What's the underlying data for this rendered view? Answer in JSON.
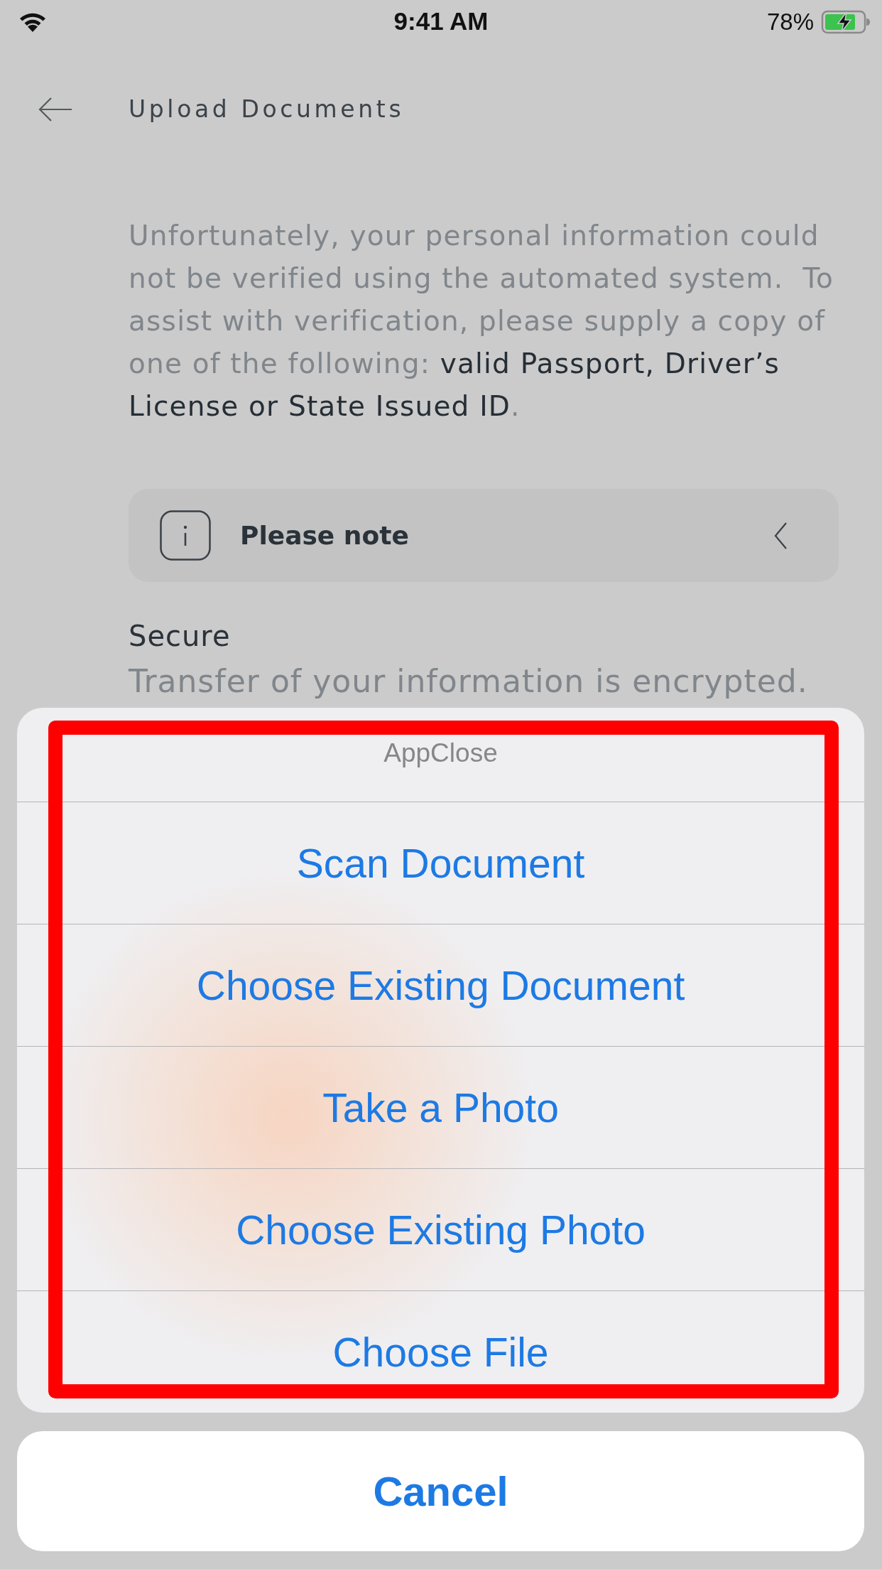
{
  "status_bar": {
    "time": "9:41 AM",
    "battery": "78%",
    "charging": true
  },
  "header": {
    "title": "Upload Documents"
  },
  "intro": "Unfortunately, your personal information could not be verified using the automated system.  To assist with verification, please supply a copy of one of the following: **valid Passport, Driver’s License or State Issued ID**.",
  "note": {
    "title": "Please note",
    "expanded": false
  },
  "secure": {
    "title": "Secure",
    "text": "Transfer of your information is encrypted."
  },
  "action_sheet": {
    "title": "AppClose",
    "options": [
      "Scan Document",
      "Choose Existing Document",
      "Take a Photo",
      "Choose Existing Photo",
      "Choose File"
    ],
    "cancel": "Cancel"
  }
}
